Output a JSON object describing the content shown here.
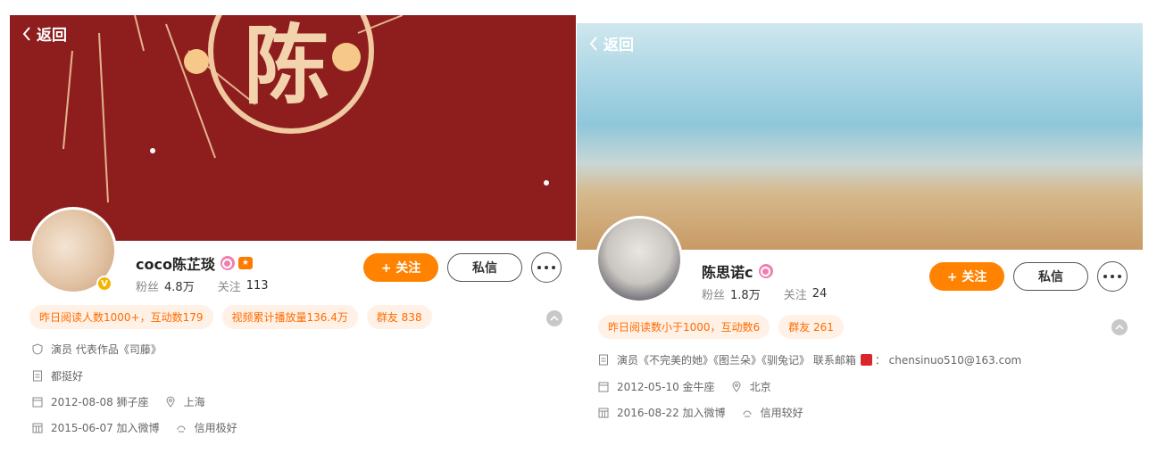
{
  "left": {
    "back_label": "返回",
    "banner_text": "陈",
    "name": "coco陈芷琰",
    "verified_mark": "V",
    "fans_label": "粉丝",
    "fans_count": "4.8万",
    "following_label": "关注",
    "following_count": "113",
    "follow_button": "+ 关注",
    "message_button": "私信",
    "tags": [
      "昨日阅读人数1000+，互动数179",
      "视频累计播放量136.4万",
      "群友 838"
    ],
    "info": {
      "profession": "演员 代表作品《司藤》",
      "bio": "都挺好",
      "birthday": "2012-08-08 狮子座",
      "location": "上海",
      "joined": "2015-06-07 加入微博",
      "credit": "信用极好"
    }
  },
  "right": {
    "back_label": "返回",
    "name": "陈思诺c",
    "fans_label": "粉丝",
    "fans_count": "1.8万",
    "following_label": "关注",
    "following_count": "24",
    "follow_button": "+ 关注",
    "message_button": "私信",
    "tags": [
      "昨日阅读数小于1000，互动数6",
      "群友 261"
    ],
    "info": {
      "bio_prefix": "演员《不完美的她》《图兰朵》《驯兔记》 联系邮箱",
      "email": "： chensinuo510@163.com",
      "birthday": "2012-05-10 金牛座",
      "location": "北京",
      "joined": "2016-08-22 加入微博",
      "credit": "信用较好"
    }
  },
  "colors": {
    "accent": "#ff8200",
    "tag_bg": "#fff1e6",
    "tag_text": "#ff6b00",
    "left_banner": "#8e1e1e"
  }
}
